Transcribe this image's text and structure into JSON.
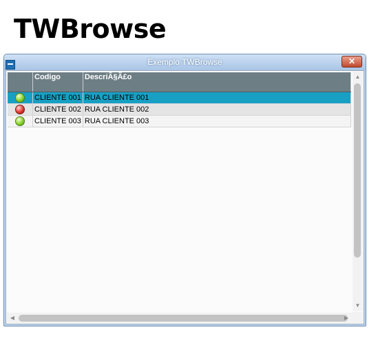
{
  "page": {
    "heading": "TWBrowse"
  },
  "window": {
    "title": "Exemplo TWBrowse",
    "close_symbol": "✕",
    "icon": "window-app-icon"
  },
  "browse": {
    "columns": [
      "",
      "Codigo",
      "DescriÃ§Ã£o"
    ],
    "rows": [
      {
        "status": "green",
        "code": "CLIENTE 001",
        "description": "RUA CLIENTE 001",
        "selected": true
      },
      {
        "status": "red",
        "code": "CLIENTE 002",
        "description": "RUA CLIENTE 002",
        "selected": false
      },
      {
        "status": "green",
        "code": "CLIENTE 003",
        "description": "RUA CLIENTE 003",
        "selected": false
      }
    ],
    "colors": {
      "header": "#6e7e85",
      "selected": "#18a0c4",
      "green": "#8ad42a",
      "red": "#e23a30"
    }
  },
  "scrollbars": {
    "up": "▲",
    "down": "▼",
    "left": "◀",
    "right": "▶"
  }
}
